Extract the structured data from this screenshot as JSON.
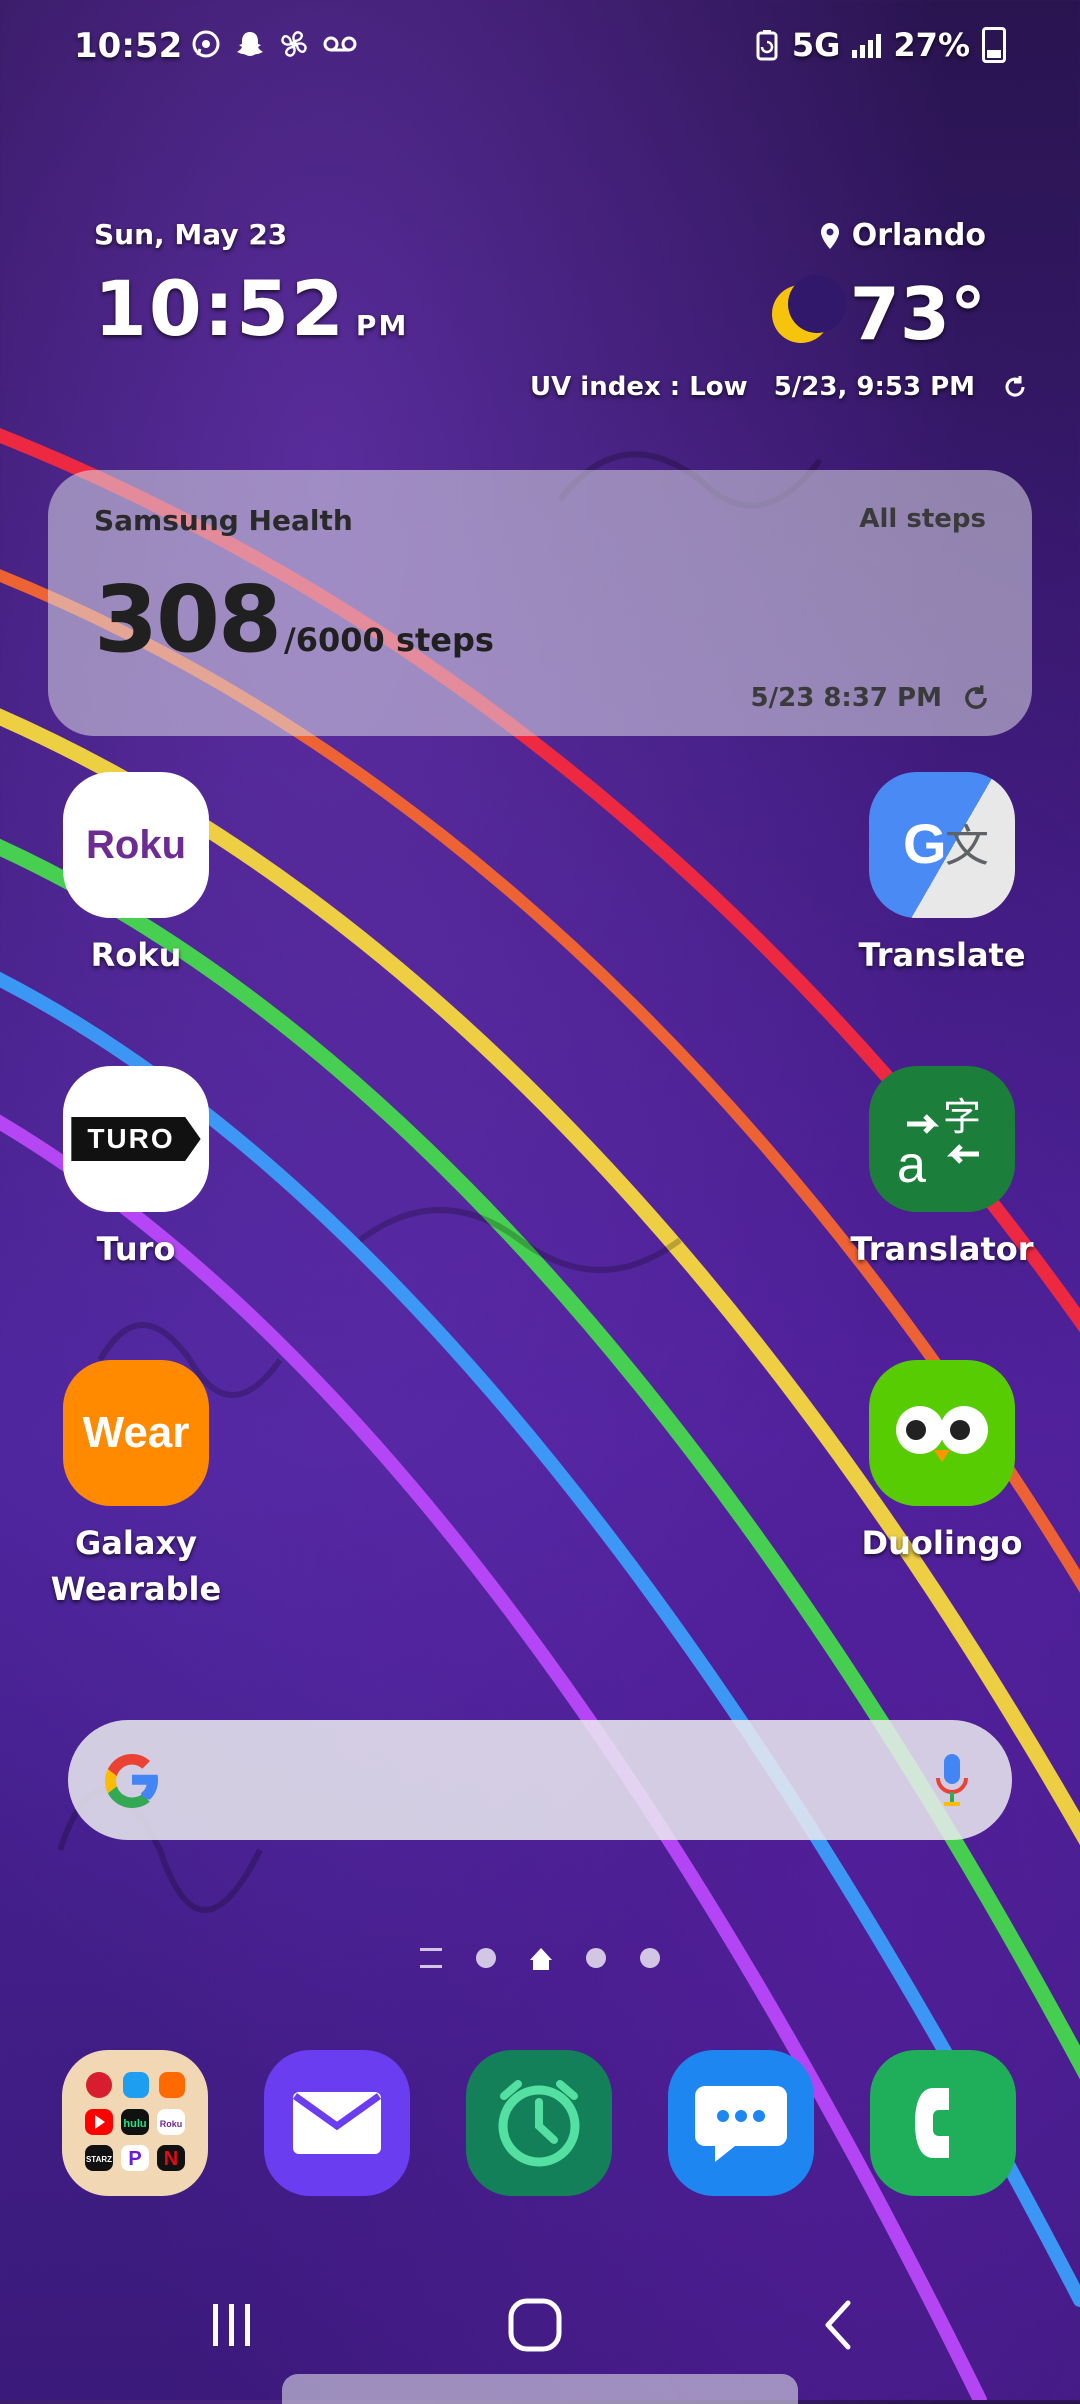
{
  "status_bar": {
    "time": "10:52",
    "network": "5G",
    "battery": "27%",
    "notification_icons": [
      "whatsapp-icon",
      "snapchat-icon",
      "fan-icon",
      "voicemail-icon"
    ]
  },
  "clock_widget": {
    "date": "Sun, May 23",
    "time": "10:52",
    "ampm": "PM",
    "location": "Orlando",
    "temperature": "73°",
    "uv_index": "UV index : Low",
    "updated": "5/23, 9:53 PM"
  },
  "health_widget": {
    "title": "Samsung Health",
    "filter": "All steps",
    "steps": "308",
    "goal": "/6000 steps",
    "updated": "5/23 8:37 PM"
  },
  "apps": {
    "roku": {
      "label": "Roku",
      "icon_text": "Roku"
    },
    "translate": {
      "label": "Translate"
    },
    "turo": {
      "label": "Turo",
      "icon_text": "TURO"
    },
    "translator": {
      "label": "Translator"
    },
    "wear": {
      "label_line1": "Galaxy",
      "label_line2": "Wearable",
      "icon_text": "Wear"
    },
    "duolingo": {
      "label": "Duolingo"
    }
  },
  "folder_icons_text": {
    "hulu": "hulu",
    "roku": "Roku",
    "starz": "STARZ"
  },
  "colors": {
    "accent_green": "#1fae5a",
    "roku_purple": "#6c2c91",
    "wear_orange": "#ff8a00",
    "email_purple": "#6a3df0",
    "messages_blue": "#1e86f0"
  }
}
